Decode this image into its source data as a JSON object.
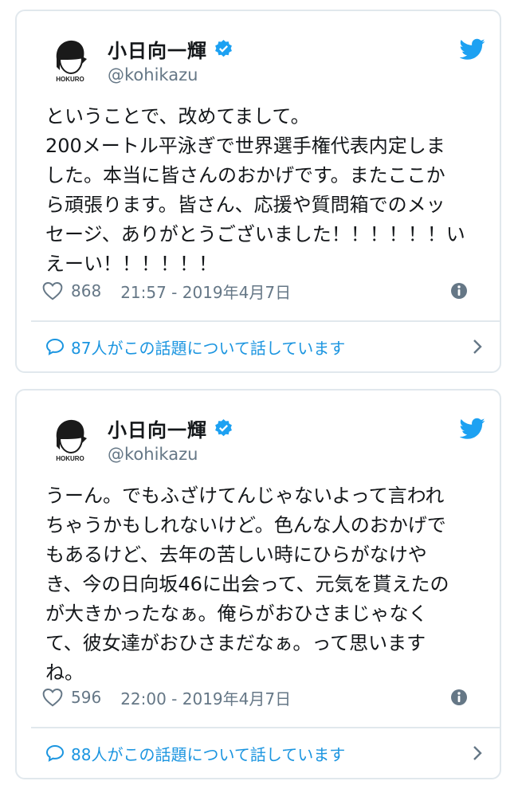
{
  "colors": {
    "accent": "#1da1f2",
    "link": "#1b95e0",
    "muted": "#657786",
    "border": "#e1e8ed",
    "text": "#14171a"
  },
  "tweets": [
    {
      "avatar_label": "HOKURO",
      "display_name": "小日向一輝",
      "handle": "@kohikazu",
      "text_lines": [
        "ということで、改めてまして。",
        "200メートル平泳ぎで世界選手権代表内定しま",
        "した。本当に皆さんのおかげです。またここか",
        "ら頑張ります。皆さん、応援や質問箱でのメッ",
        "セージ、ありがとうございました！！！！！！い",
        "えーい！！！！！！"
      ],
      "likes": "868",
      "timestamp": "21:57 - 2019年4月7日",
      "conversation": "87人がこの話題について話しています"
    },
    {
      "avatar_label": "HOKURO",
      "display_name": "小日向一輝",
      "handle": "@kohikazu",
      "text_lines": [
        "うーん。でもふざけてんじゃないよって言われ",
        "ちゃうかもしれないけど。色んな人のおかげで",
        "もあるけど、去年の苦しい時にひらがなけや",
        "き、今の日向坂46に出会って、元気を貰えたの",
        "が大きかったなぁ。俺らがおひさまじゃなく",
        "て、彼女達がおひさまだなぁ。って思います",
        "ね。"
      ],
      "likes": "596",
      "timestamp": "22:00 - 2019年4月7日",
      "conversation": "88人がこの話題について話しています"
    }
  ]
}
